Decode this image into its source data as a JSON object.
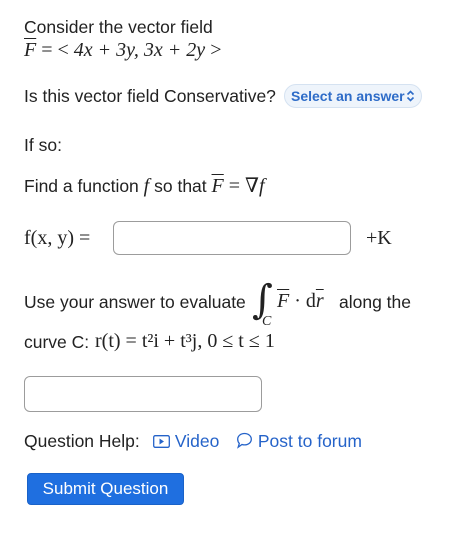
{
  "intro": {
    "text": "Consider the vector field",
    "field_lhs": "F",
    "field_eq": " =  < ",
    "field_rhs": "4x + 3y, 3x + 2y",
    "field_close": " >"
  },
  "question1": {
    "text": "Is this vector field Conservative?",
    "select_value": "Select an answer"
  },
  "if_so": "If so:",
  "question2": {
    "text": "Find a function",
    "f": "f",
    "mid": "so that",
    "F": "F",
    "eq": " = ∇",
    "f2": "f"
  },
  "answer_row": {
    "label": "f(x, y) =",
    "input_value": "",
    "suffix": "+K"
  },
  "question3": {
    "text": "Use your answer to evaluate",
    "integral": "∫",
    "sub": "C",
    "F": "F",
    "dot": " · d",
    "r": "r",
    "after": "along the",
    "line2_text": "curve C:",
    "curve_expr": "r(t) = t²i + t³j,   0 ≤ t ≤ 1"
  },
  "answer2": {
    "input_value": ""
  },
  "help": {
    "label": "Question Help:",
    "video": "Video",
    "forum": "Post to forum"
  },
  "submit_label": "Submit Question"
}
